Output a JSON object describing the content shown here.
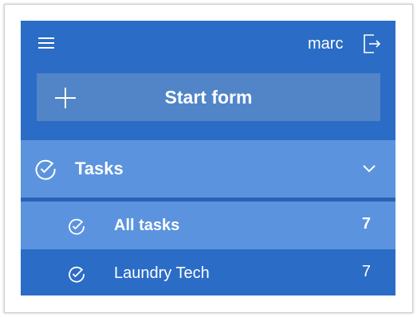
{
  "header": {
    "menu_icon": "hamburger-icon",
    "username": "marc",
    "logout_icon": "sign-out-icon"
  },
  "start_form": {
    "icon": "plus-icon",
    "label": "Start form"
  },
  "tasks_section": {
    "icon": "check-circle-icon",
    "title": "Tasks",
    "expand_icon": "chevron-down-icon",
    "items": [
      {
        "label": "All tasks",
        "count": "7",
        "icon": "check-circle-icon",
        "selected": true
      },
      {
        "label": "Laundry Tech",
        "count": "7",
        "icon": "check-circle-icon",
        "selected": false
      }
    ]
  },
  "colors": {
    "panel_bg": "#2b6cc6",
    "button_bg": "#5185c8",
    "selected_bg": "#5b93de",
    "text": "#ffffff"
  }
}
